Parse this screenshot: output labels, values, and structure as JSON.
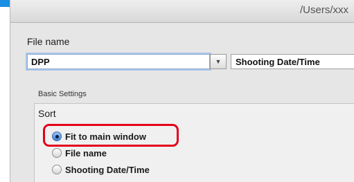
{
  "path": "/Users/xxx",
  "file_name": {
    "label": "File name",
    "prefix_value": "DPP",
    "format_value": "Shooting Date/Time"
  },
  "basic_settings": {
    "title": "Basic Settings",
    "sort_label": "Sort",
    "options": [
      {
        "label": "Fit to main window",
        "selected": true
      },
      {
        "label": "File name",
        "selected": false
      },
      {
        "label": "Shooting Date/Time",
        "selected": false
      }
    ]
  },
  "colors": {
    "accent": "#e3001b",
    "corner": "#1a8fe3"
  }
}
